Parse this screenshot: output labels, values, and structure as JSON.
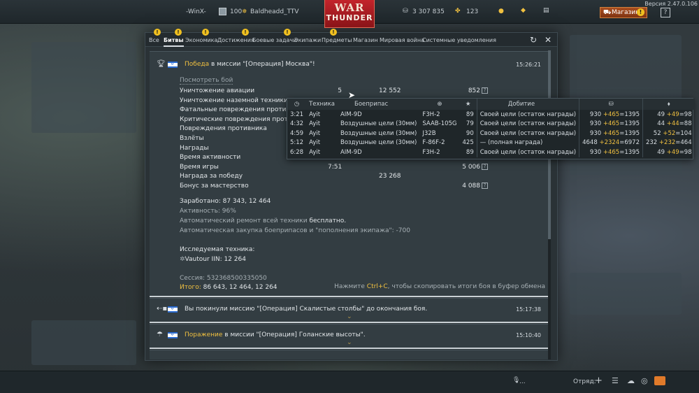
{
  "topbar": {
    "player_name": "-WinX-",
    "squadmate_rank": "100",
    "squadmate_name": "Baldheadd_TTV",
    "logo_line1": "WAR",
    "logo_line2": "THUNDER",
    "silver_lions": "3 307 835",
    "golden_eagles": "123",
    "shop_label": "Магазин",
    "version": "Версия 2.47.0.106"
  },
  "tabs": [
    {
      "label": "Все"
    },
    {
      "label": "Битвы"
    },
    {
      "label": "Экономика"
    },
    {
      "label": "Достижения"
    },
    {
      "label": "Боевые задачи"
    },
    {
      "label": "Экипажи"
    },
    {
      "label": "Предметы"
    },
    {
      "label": "Магазин"
    },
    {
      "label": "Мировая война"
    },
    {
      "label": "Системные уведомления"
    }
  ],
  "tab_badge_glyph": "!",
  "entries": {
    "e1": {
      "result_word": "Победа",
      "title_rest": " в миссии \"[Операция] Москва\"!",
      "time": "15:26:21",
      "view_battle": "Посмотреть бой",
      "stats": [
        {
          "label": "Уничтожение авиации",
          "count": "5",
          "silver": "12 552",
          "rp": "852",
          "q": "?"
        },
        {
          "label": "Уничтожение наземной техники",
          "count": "",
          "silver": "",
          "rp": "",
          "q": ""
        },
        {
          "label": "Фатальные повреждения противник",
          "count": "",
          "silver": "",
          "rp": "",
          "q": ""
        },
        {
          "label": "Критические повреждения противни",
          "count": "",
          "silver": "",
          "rp": "",
          "q": ""
        },
        {
          "label": "Повреждения противника",
          "count": "",
          "silver": "",
          "rp": "",
          "q": ""
        },
        {
          "label": "Взлёты",
          "count": "",
          "silver": "",
          "rp": "",
          "q": ""
        },
        {
          "label": "Награды",
          "count": "",
          "silver": "",
          "rp": "",
          "q": ""
        },
        {
          "label": "Время активности",
          "count": "",
          "silver": "",
          "rp": "",
          "q": ""
        },
        {
          "label": "Время игры",
          "count": "7:51",
          "silver": "",
          "rp": "5 006",
          "q": "?"
        },
        {
          "label": "Награда за победу",
          "count": "",
          "silver": "23 268",
          "rp": "",
          "q": ""
        },
        {
          "label": "Бонус за мастерство",
          "count": "",
          "silver": "",
          "rp": "4 088",
          "q": "?"
        }
      ],
      "earned": "Заработано: 87 343, 12 464",
      "activity": "Активность: 96%",
      "repair_prefix": "Автоматический ремонт всей техники ",
      "repair_value": "бесплатно.",
      "ammo": "Автоматическая закупка боеприпасов и \"пополнения экипажа\": -700",
      "research_title": "Исследуемая техника:",
      "research_vehicle": "Vautour IIN: 12 264",
      "session": "Сессия: 532368500335050",
      "total_label": "Итого:",
      "total_value": " 86 643, 12 464, 12 264",
      "copy_hint_pre": "Нажмите ",
      "copy_hint_key": "Ctrl+C",
      "copy_hint_post": ", чтобы скопировать итоги боя в буфер обмена"
    },
    "e2": {
      "title": "Вы покинули миссию \"[Операция] Скалистые столбы\" до окончания боя.",
      "time": "15:17:38"
    },
    "e3": {
      "result_word": "Поражение",
      "title_rest": " в миссии \"[Операция] Голанские высоты\".",
      "time": "15:10:40"
    }
  },
  "popup": {
    "headers": {
      "time": "◷",
      "vehicle": "Техника",
      "ammo": "Боеприпас",
      "target_icon": "⊕",
      "star": "★",
      "finish": "Добитие",
      "silver": "⛁",
      "rp": "⬧"
    },
    "rows": [
      {
        "time": "3:21",
        "vehicle": "Ayit",
        "ammo": "AIM-9D",
        "target": "F3H-2",
        "score": "89",
        "finish": "Своей цели (остаток награды)",
        "s_base": "930",
        "s_bonus": "465",
        "s_total": "=1395",
        "r_base": "49",
        "r_bonus": "49",
        "r_total": "=98"
      },
      {
        "time": "4:32",
        "vehicle": "Ayit",
        "ammo": "Воздушные цели (30мм)",
        "target": "SAAB-105G",
        "score": "79",
        "finish": "Своей цели (остаток награды)",
        "s_base": "930",
        "s_bonus": "465",
        "s_total": "=1395",
        "r_base": "44",
        "r_bonus": "44",
        "r_total": "=88"
      },
      {
        "time": "4:59",
        "vehicle": "Ayit",
        "ammo": "Воздушные цели (30мм)",
        "target": "J32B",
        "score": "90",
        "finish": "Своей цели (остаток награды)",
        "s_base": "930",
        "s_bonus": "465",
        "s_total": "=1395",
        "r_base": "52",
        "r_bonus": "52",
        "r_total": "=104"
      },
      {
        "time": "5:12",
        "vehicle": "Ayit",
        "ammo": "Воздушные цели (30мм)",
        "target": "F-86F-2",
        "score": "425",
        "finish": "— (полная награда)",
        "s_base": "4648",
        "s_bonus": "2324",
        "s_total": "=6972",
        "r_base": "232",
        "r_bonus": "232",
        "r_total": "=464"
      },
      {
        "time": "6:28",
        "vehicle": "Ayit",
        "ammo": "AIM-9D",
        "target": "F3H-2",
        "score": "89",
        "finish": "Своей цели (остаток награды)",
        "s_base": "930",
        "s_bonus": "465",
        "s_total": "=1395",
        "r_base": "49",
        "r_bonus": "49",
        "r_total": "=98"
      }
    ]
  },
  "bottombar": {
    "voice": "...",
    "squad_label": "Отряд:"
  },
  "colors": {
    "accent_gold": "#f0c040",
    "logo_red": "#c3242b",
    "shop_orange": "#a94e20"
  }
}
